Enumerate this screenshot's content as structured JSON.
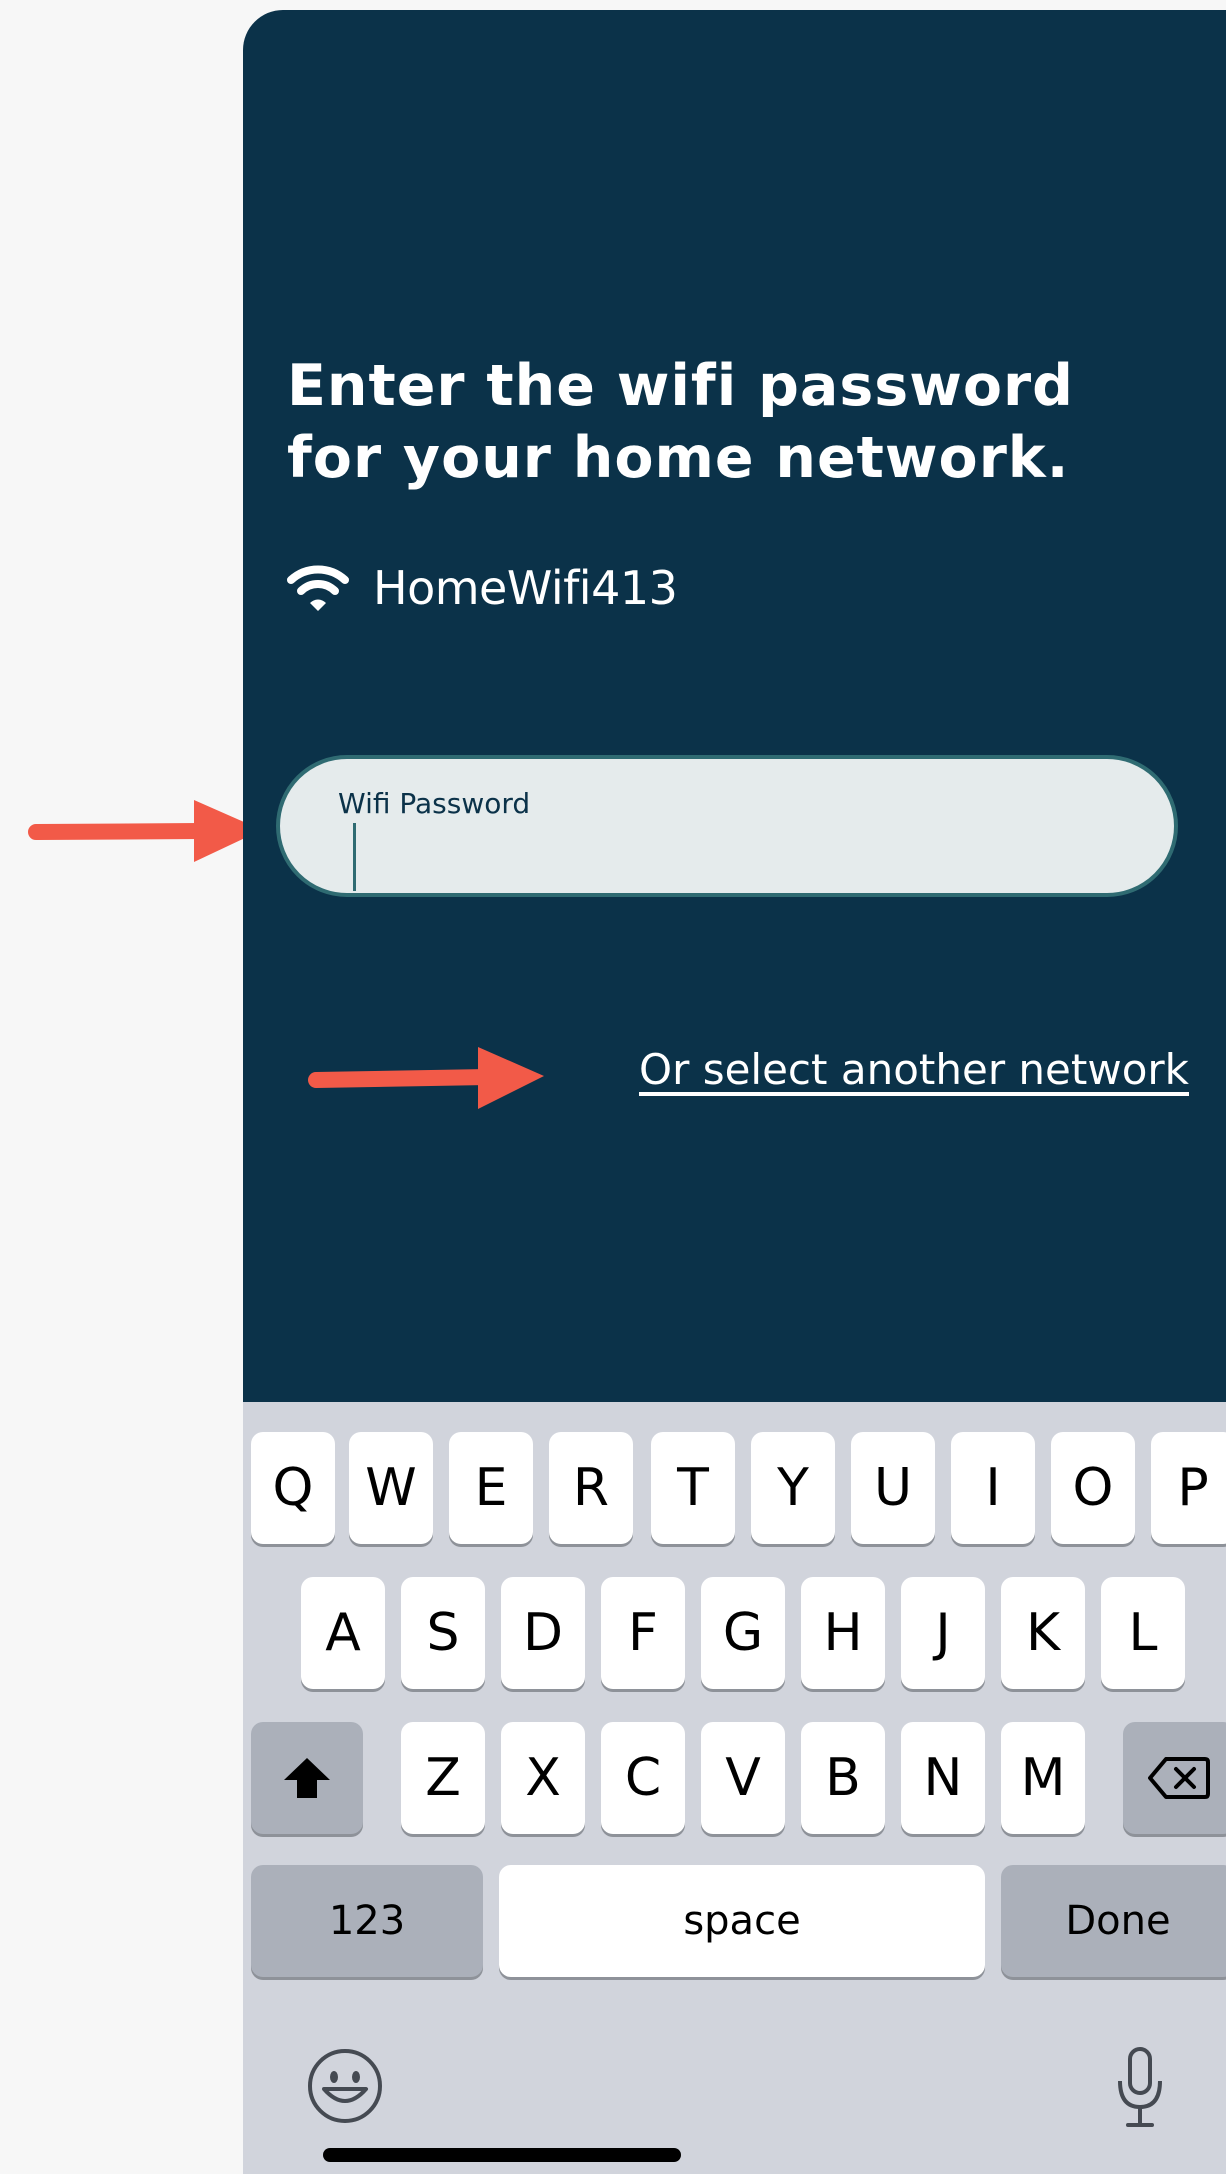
{
  "screen": {
    "title": "Enter the wifi password for your home network.",
    "network_name": "HomeWifi413",
    "password_field": {
      "label": "Wifi Password",
      "value": ""
    },
    "select_network_link": "Or select another network"
  },
  "keyboard": {
    "row1": [
      "Q",
      "W",
      "E",
      "R",
      "T",
      "Y",
      "U",
      "I",
      "O",
      "P"
    ],
    "row2": [
      "A",
      "S",
      "D",
      "F",
      "G",
      "H",
      "J",
      "K",
      "L"
    ],
    "row3": [
      "Z",
      "X",
      "C",
      "V",
      "B",
      "N",
      "M"
    ],
    "numbers_key": "123",
    "space_key": "space",
    "done_key": "Done"
  },
  "colors": {
    "background": "#0b3249",
    "field_border": "#2f6b72",
    "field_fill": "#e5ebec",
    "annotation_arrow": "#f25a48",
    "keyboard_bg": "#d1d4dc"
  },
  "icons": [
    "wifi-icon",
    "shift-icon",
    "backspace-icon",
    "emoji-icon",
    "microphone-icon",
    "arrow-icon"
  ]
}
